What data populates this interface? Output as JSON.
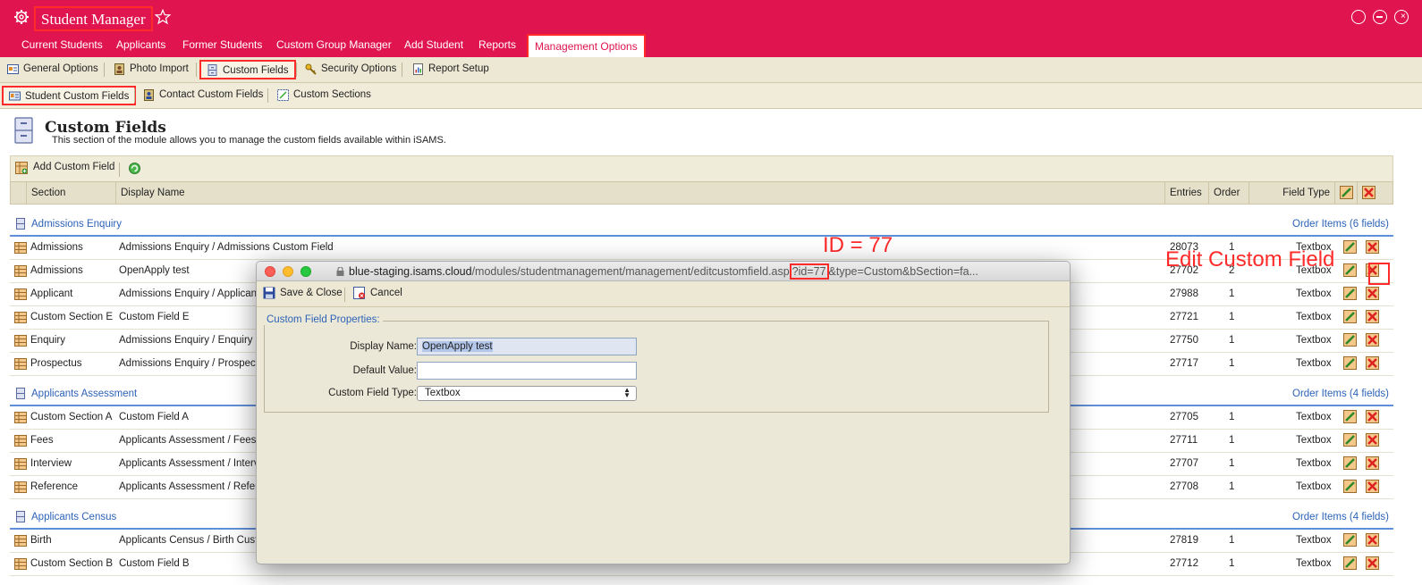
{
  "app": {
    "title": "Student Manager"
  },
  "mainnav": [
    "Current Students",
    "Applicants",
    "Former Students",
    "Custom Group Manager",
    "Add Student",
    "Reports",
    "Management Options"
  ],
  "toolbar1": [
    "General Options",
    "Photo Import",
    "Custom Fields",
    "Security Options",
    "Report Setup"
  ],
  "toolbar2": [
    "Student Custom Fields",
    "Contact Custom Fields",
    "Custom Sections"
  ],
  "page": {
    "title": "Custom Fields",
    "description": "This section of the module allows you to manage the custom fields available within iSAMS.",
    "add_label": "Add Custom Field"
  },
  "columns": {
    "section": "Section",
    "display_name": "Display Name",
    "entries": "Entries",
    "order": "Order",
    "field_type": "Field Type"
  },
  "sections": [
    {
      "name": "Admissions Enquiry",
      "order_label": "Order Items (6 fields)",
      "rows": [
        {
          "section": "Admissions",
          "display": "Admissions Enquiry / Admissions Custom Field",
          "entries": "28073",
          "order": "1",
          "type": "Textbox"
        },
        {
          "section": "Admissions",
          "display": "OpenApply test",
          "entries": "27702",
          "order": "2",
          "type": "Textbox"
        },
        {
          "section": "Applicant",
          "display": "Admissions Enquiry / Applicant",
          "entries": "27988",
          "order": "1",
          "type": "Textbox"
        },
        {
          "section": "Custom Section E",
          "display": "Custom Field E",
          "entries": "27721",
          "order": "1",
          "type": "Textbox"
        },
        {
          "section": "Enquiry",
          "display": "Admissions Enquiry / Enquiry Cu",
          "entries": "27750",
          "order": "1",
          "type": "Textbox"
        },
        {
          "section": "Prospectus",
          "display": "Admissions Enquiry / Prospectu",
          "entries": "27717",
          "order": "1",
          "type": "Textbox"
        }
      ]
    },
    {
      "name": "Applicants Assessment",
      "order_label": "Order Items (4 fields)",
      "rows": [
        {
          "section": "Custom Section A",
          "display": "Custom Field A",
          "entries": "27705",
          "order": "1",
          "type": "Textbox"
        },
        {
          "section": "Fees",
          "display": "Applicants Assessment / Fees C",
          "entries": "27711",
          "order": "1",
          "type": "Textbox"
        },
        {
          "section": "Interview",
          "display": "Applicants Assessment / Intervi",
          "entries": "27707",
          "order": "1",
          "type": "Textbox"
        },
        {
          "section": "Reference",
          "display": "Applicants Assessment / Refere",
          "entries": "27708",
          "order": "1",
          "type": "Textbox"
        }
      ]
    },
    {
      "name": "Applicants Census",
      "order_label": "Order Items (4 fields)",
      "rows": [
        {
          "section": "Birth",
          "display": "Applicants Census / Birth Custo",
          "entries": "27819",
          "order": "1",
          "type": "Textbox"
        },
        {
          "section": "Custom Section B",
          "display": "Custom Field B",
          "entries": "27712",
          "order": "1",
          "type": "Textbox"
        }
      ]
    }
  ],
  "annotations": {
    "id": "ID = 77",
    "edit": "Edit Custom Field"
  },
  "modal": {
    "url_host": "blue-staging.isams.cloud",
    "url_path": "/modules/studentmanagement/management/editcustomfield.asp",
    "url_highlight": "?id=77",
    "url_rest": "&type=Custom&bSection=fa...",
    "save_label": "Save & Close",
    "cancel_label": "Cancel",
    "legend": "Custom Field Properties:",
    "display_name_label": "Display Name:",
    "display_name_value": "OpenApply test",
    "default_value_label": "Default Value:",
    "default_value_value": "",
    "type_label": "Custom Field Type:",
    "type_value": "Textbox"
  },
  "colors": {
    "brand": "#e0144f",
    "annotation": "#ff2a2a",
    "link": "#2d63b8"
  }
}
